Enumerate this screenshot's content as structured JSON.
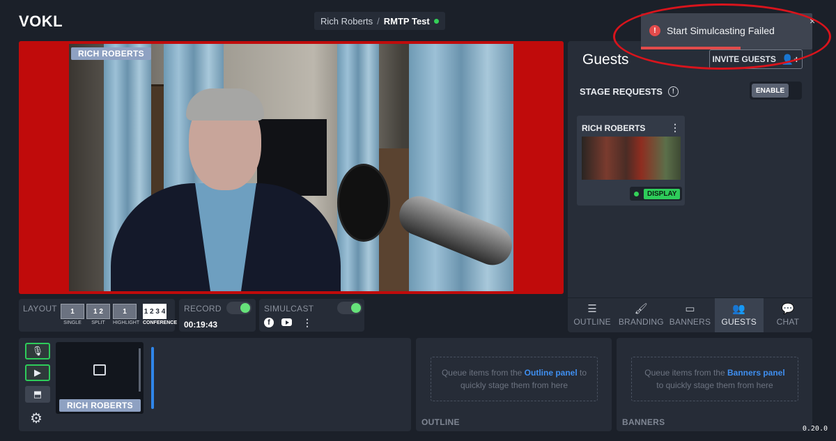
{
  "app": {
    "logo": "VOKL",
    "version": "0.20.0"
  },
  "breadcrumb": {
    "user": "Rich Roberts",
    "separator": "/",
    "show": "RMTP Test"
  },
  "stage": {
    "participant_label": "RICH ROBERTS"
  },
  "controls": {
    "layout": {
      "label": "LAYOUT",
      "options": [
        {
          "caption": "SINGLE",
          "glyph": "1"
        },
        {
          "caption": "SPLIT",
          "glyph": "1 2"
        },
        {
          "caption": "HIGHLIGHT",
          "glyph": "1"
        },
        {
          "caption": "CONFERENCE",
          "glyph": "1 2 3 4"
        }
      ]
    },
    "record": {
      "label": "RECORD",
      "time": "00:19:43",
      "enabled": true
    },
    "simulcast": {
      "label": "SIMULCAST",
      "enabled": true,
      "destinations": [
        "facebook-icon",
        "youtube-icon"
      ]
    }
  },
  "guests_panel": {
    "title": "Guests",
    "invite_label": "INVITE GUESTS",
    "stage_requests_label": "STAGE REQUESTS",
    "enable_label": "ENABLE",
    "guests": [
      {
        "name": "RICH ROBERTS",
        "action": "DISPLAY"
      }
    ]
  },
  "tabs": [
    {
      "label": "OUTLINE",
      "icon": "outline-icon"
    },
    {
      "label": "BRANDING",
      "icon": "branding-icon"
    },
    {
      "label": "BANNERS",
      "icon": "banners-icon"
    },
    {
      "label": "GUESTS",
      "icon": "guests-icon",
      "active": true
    },
    {
      "label": "CHAT",
      "icon": "chat-icon"
    }
  ],
  "backstage": {
    "participant_label": "RICH ROBERTS"
  },
  "queues": {
    "outline": {
      "label": "OUTLINE",
      "pre": "Queue items from the ",
      "link": "Outline panel",
      "post": " to",
      "line2": "quickly stage them from here"
    },
    "banners": {
      "label": "BANNERS",
      "pre": "Queue items from the ",
      "link": "Banners panel",
      "post": "",
      "line2": "to quickly stage them from here"
    }
  },
  "toast": {
    "message": "Start Simulcasting Failed",
    "close": "×",
    "progress": 0.58,
    "color": "#e24b4b"
  },
  "colors": {
    "accent": "#3f8ff0",
    "live_green": "#34d058",
    "stage_border": "#c00b0b"
  }
}
